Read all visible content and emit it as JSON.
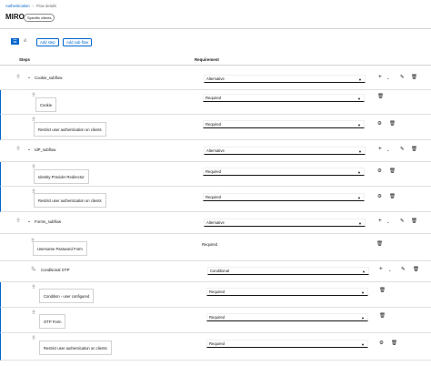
{
  "breadcrumb": {
    "parent": "Authentication",
    "current": "Flow details"
  },
  "page": {
    "title": "MIRO",
    "badge": "Specific clients"
  },
  "toolbar": {
    "add_step": "Add step",
    "add_sub_flow": "Add sub-flow"
  },
  "table": {
    "col_steps": "Steps",
    "col_requirement": "Requirement"
  },
  "rows": [
    {
      "id": "r0",
      "name": "Cookie_subflow",
      "requirement": "Alternative"
    },
    {
      "id": "r1",
      "name": "Cookie",
      "requirement": "Required"
    },
    {
      "id": "r2",
      "name": "Restrict user authentication on clients",
      "requirement": "Required"
    },
    {
      "id": "r3",
      "name": "IdP_subflow",
      "requirement": "Alternative"
    },
    {
      "id": "r4",
      "name": "Identity Provider Redirector",
      "requirement": "Required"
    },
    {
      "id": "r5",
      "name": "Restrict user authentication on clients",
      "requirement": "Required"
    },
    {
      "id": "r6",
      "name": "Forms_subflow",
      "requirement": "Alternative"
    },
    {
      "id": "r7",
      "name": "Username Password Form",
      "requirement": "Required"
    },
    {
      "id": "r8",
      "name": "Conditional OTP",
      "requirement": "Conditional"
    },
    {
      "id": "r9",
      "name": "Condition - user configured",
      "requirement": "Required"
    },
    {
      "id": "r10",
      "name": "OTP Form",
      "requirement": "Required"
    },
    {
      "id": "r11",
      "name": "Restrict user authentication on clients",
      "requirement": "Required"
    }
  ],
  "colors": {
    "accent": "#0066cc",
    "border": "#d2d2d2"
  }
}
